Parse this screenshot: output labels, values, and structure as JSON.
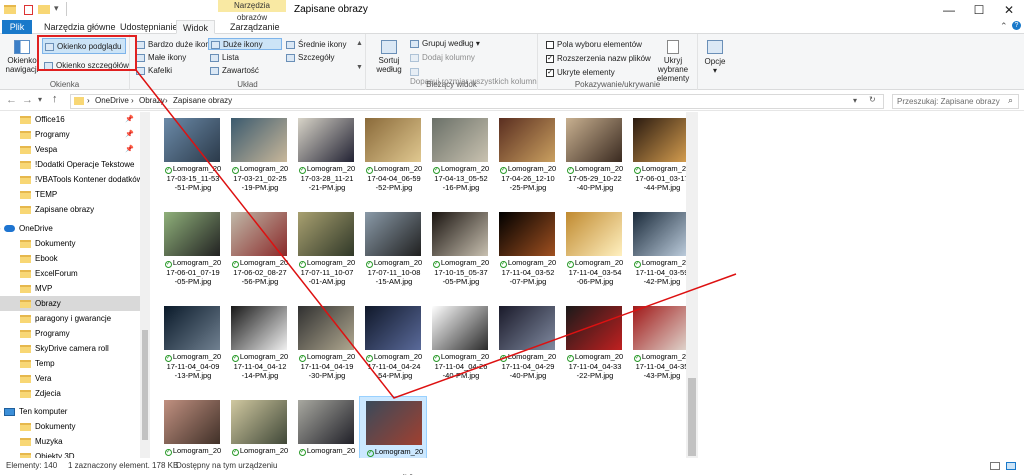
{
  "window": {
    "title": "Zapisane obrazy",
    "context_header": "Narzędzia obrazów",
    "controls": [
      "—",
      "☐",
      "✕"
    ]
  },
  "tabs": [
    "Plik",
    "Narzędzia główne",
    "Udostępnianie",
    "Widok",
    "Zarządzanie"
  ],
  "ribbon": {
    "panes": {
      "nav_pane": "Okienko nawigacji",
      "preview_pane": "Okienko podglądu",
      "details_pane": "Okienko szczegółów",
      "group_label": "Okienka"
    },
    "layout": {
      "items": [
        "Bardzo duże ikony",
        "Duże ikony",
        "Średnie ikony",
        "Małe ikony",
        "Lista",
        "Szczegóły",
        "Kafelki",
        "Zawartość"
      ],
      "group_label": "Układ"
    },
    "current_view": {
      "sort": "Sortuj według",
      "group_by": "Grupuj według",
      "add_columns": "Dodaj kolumny",
      "fit_columns": "Dopasuj rozmiar wszystkich kolumn",
      "group_label": "Bieżący widok"
    },
    "show_hide": {
      "item_checkboxes": "Pola wyboru elementów",
      "file_extensions": "Rozszerzenia nazw plików",
      "hidden_items": "Ukryte elementy",
      "hide_selected": "Ukryj wybrane elementy",
      "group_label": "Pokazywanie/ukrywanie"
    },
    "options": "Opcje",
    "checked": {
      "item_checkboxes": false,
      "file_extensions": true,
      "hidden_items": true
    }
  },
  "address": {
    "crumbs": [
      "OneDrive",
      "Obrazy",
      "Zapisane obrazy"
    ],
    "search_placeholder": "Przeszukaj: Zapisane obrazy"
  },
  "nav": [
    {
      "label": "Office16",
      "icon": "folder",
      "pinned": true
    },
    {
      "label": "Programy",
      "icon": "folder",
      "pinned": true
    },
    {
      "label": "Vespa",
      "icon": "folder",
      "pinned": true
    },
    {
      "label": "!Dodatki Operacje Tekstowe",
      "icon": "folder"
    },
    {
      "label": "!VBATools Kontener dodatków",
      "icon": "folder"
    },
    {
      "label": "TEMP",
      "icon": "folder"
    },
    {
      "label": "Zapisane obrazy",
      "icon": "folder"
    },
    {
      "label": "OneDrive",
      "icon": "cloud"
    },
    {
      "label": "Dokumenty",
      "icon": "folder"
    },
    {
      "label": "Ebook",
      "icon": "folder"
    },
    {
      "label": "ExcelForum",
      "icon": "folder"
    },
    {
      "label": "MVP",
      "icon": "folder"
    },
    {
      "label": "Obrazy",
      "icon": "folder",
      "selected": true
    },
    {
      "label": "paragony i gwarancje",
      "icon": "folder"
    },
    {
      "label": "Programy",
      "icon": "folder"
    },
    {
      "label": "SkyDrive camera roll",
      "icon": "folder"
    },
    {
      "label": "Temp",
      "icon": "folder"
    },
    {
      "label": "Vera",
      "icon": "folder"
    },
    {
      "label": "Zdjecia",
      "icon": "folder"
    },
    {
      "label": "Ten komputer",
      "icon": "pc"
    },
    {
      "label": "Dokumenty",
      "icon": "folder"
    },
    {
      "label": "Muzyka",
      "icon": "folder"
    },
    {
      "label": "Obiekty 3D",
      "icon": "folder"
    }
  ],
  "files": [
    {
      "name": "Lomogram_20\n17-03-15_11-53\n-51-PM.jpg",
      "colors": [
        "#6b8aa8",
        "#2b3a4a"
      ]
    },
    {
      "name": "Lomogram_20\n17-03-21_02-25\n-19-PM.jpg",
      "colors": [
        "#3b5a6e",
        "#c8b79a"
      ]
    },
    {
      "name": "Lomogram_20\n17-03-28_11-21\n-21-PM.jpg",
      "colors": [
        "#d8d4c8",
        "#223"
      ]
    },
    {
      "name": "Lomogram_20\n17-04-04_06-59\n-52-PM.jpg",
      "colors": [
        "#8a6a3a",
        "#e0c890"
      ]
    },
    {
      "name": "Lomogram_20\n17-04-13_05-52\n-16-PM.jpg",
      "colors": [
        "#6a7068",
        "#c9c2b0"
      ]
    },
    {
      "name": "Lomogram_20\n17-04-26_12-10\n-25-PM.jpg",
      "colors": [
        "#5a2e20",
        "#caa060"
      ]
    },
    {
      "name": "Lomogram_20\n17-05-29_10-22\n-40-PM.jpg",
      "colors": [
        "#c8b090",
        "#3a2a20"
      ]
    },
    {
      "name": "Lomogram_20\n17-06-01_03-17\n-44-PM.jpg",
      "colors": [
        "#2a1a10",
        "#d8a050"
      ]
    },
    {
      "name": "Lomogram_20\n17-06-01_07-19\n-05-PM.jpg",
      "colors": [
        "#8fb07a",
        "#222"
      ]
    },
    {
      "name": "Lomogram_20\n17-06-02_08-27\n-56-PM.jpg",
      "colors": [
        "#c0b8a8",
        "#8a2a2a"
      ]
    },
    {
      "name": "Lomogram_20\n17-07-11_10-07\n-01-AM.jpg",
      "colors": [
        "#a8a070",
        "#303828"
      ]
    },
    {
      "name": "Lomogram_20\n17-07-11_10-08\n-15-AM.jpg",
      "colors": [
        "#8a9aa8",
        "#202020"
      ]
    },
    {
      "name": "Lomogram_20\n17-10-15_05-37\n-05-PM.jpg",
      "colors": [
        "#1a1410",
        "#c8c0b0"
      ]
    },
    {
      "name": "Lomogram_20\n17-11-04_03-52\n-07-PM.jpg",
      "colors": [
        "#000000",
        "#a05020"
      ]
    },
    {
      "name": "Lomogram_20\n17-11-04_03-54\n-06-PM.jpg",
      "colors": [
        "#c08a30",
        "#fff0c0"
      ]
    },
    {
      "name": "Lomogram_20\n17-11-04_03-59\n-42-PM.jpg",
      "colors": [
        "#1a2a3a",
        "#c0d0e0"
      ]
    },
    {
      "name": "Lomogram_20\n17-11-04_04-09\n-13-PM.jpg",
      "colors": [
        "#0a1a2a",
        "#708090"
      ]
    },
    {
      "name": "Lomogram_20\n17-11-04_04-12\n-14-PM.jpg",
      "colors": [
        "#181818",
        "#f0f0f0"
      ]
    },
    {
      "name": "Lomogram_20\n17-11-04_04-19\n-30-PM.jpg",
      "colors": [
        "#303030",
        "#b0a890"
      ]
    },
    {
      "name": "Lomogram_20\n17-11-04_04-24\n-54-PM.jpg",
      "colors": [
        "#10182a",
        "#5a6a9a"
      ]
    },
    {
      "name": "Lomogram_20\n17-11-04_04-26\n-40-PM.jpg",
      "colors": [
        "#ffffff",
        "#2a2a2a"
      ]
    },
    {
      "name": "Lomogram_20\n17-11-04_04-29\n-40-PM.jpg",
      "colors": [
        "#1a1a2a",
        "#808aa0"
      ]
    },
    {
      "name": "Lomogram_20\n17-11-04_04-33\n-22-PM.jpg",
      "colors": [
        "#1a1a1a",
        "#c02020"
      ]
    },
    {
      "name": "Lomogram_20\n17-11-04_04-35\n-43-PM.jpg",
      "colors": [
        "#a01818",
        "#e0d8d0"
      ]
    },
    {
      "name": "Lomogram_20\n17-11-04_04-38\n-48-PM.jpg",
      "colors": [
        "#c09080",
        "#403028"
      ]
    },
    {
      "name": "Lomogram_20\n17-11-06_02-10\n-35-AM.jpg",
      "colors": [
        "#d0c8a0",
        "#404838"
      ]
    },
    {
      "name": "Lomogram_20\n17-11-06_02-22\n-13-AM.jpg",
      "colors": [
        "#a8a8a0",
        "#202028"
      ]
    },
    {
      "name": "Lomogram_20\n17-12-06_04-13\n-02-PM.jpg",
      "colors": [
        "#3a4a5a",
        "#a04030"
      ],
      "selected": true
    }
  ],
  "status": {
    "count": "Elementy: 140",
    "selection": "1 zaznaczony element. 178 KB",
    "availability": "Dostępny na tym urządzeniu"
  }
}
